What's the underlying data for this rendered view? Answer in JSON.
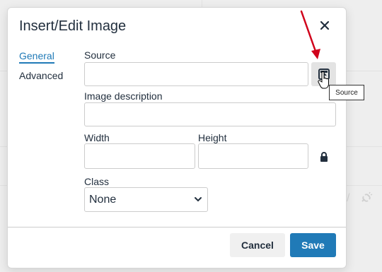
{
  "dialog": {
    "title": "Insert/Edit Image",
    "close_icon": "close-icon"
  },
  "tabs": [
    {
      "label": "General",
      "active": true
    },
    {
      "label": "Advanced",
      "active": false
    }
  ],
  "fields": {
    "source": {
      "label": "Source",
      "value": "",
      "button_icon": "browse-image-icon",
      "tooltip": "Source"
    },
    "description": {
      "label": "Image description",
      "value": ""
    },
    "width": {
      "label": "Width",
      "value": ""
    },
    "height": {
      "label": "Height",
      "value": ""
    },
    "lock_icon": "lock-icon",
    "class": {
      "label": "Class",
      "value": "None"
    }
  },
  "footer": {
    "cancel_label": "Cancel",
    "save_label": "Save"
  },
  "colors": {
    "accent": "#207ab7",
    "text": "#222f3e",
    "annotation_arrow": "#d0021b"
  }
}
